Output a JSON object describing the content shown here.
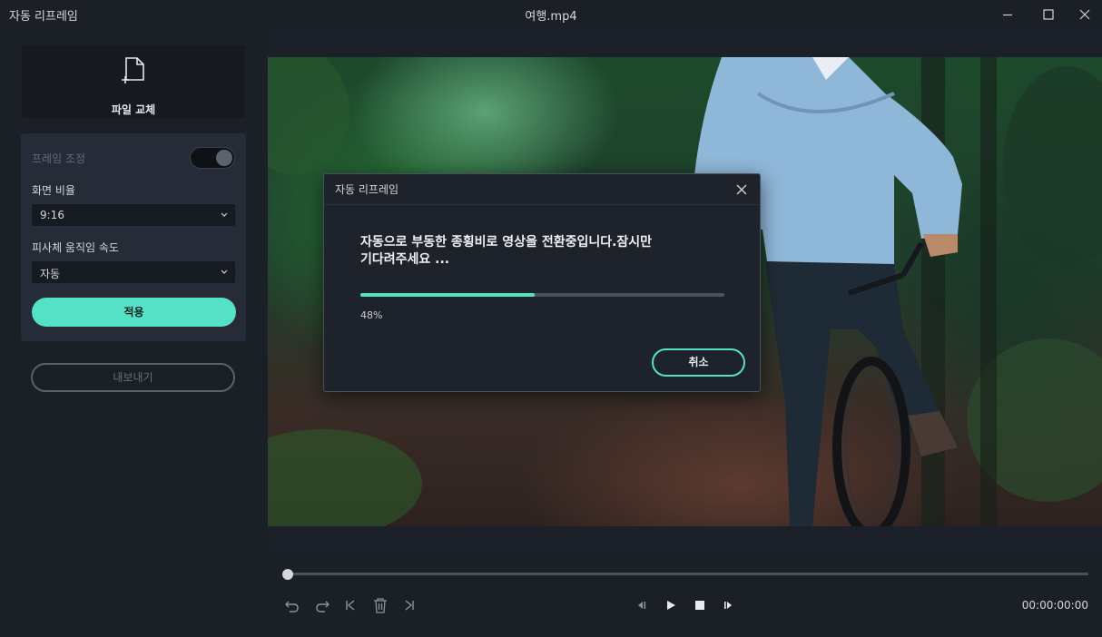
{
  "window": {
    "app_title": "자동 리프레임",
    "file_title": "여행.mp4",
    "controls": [
      "minimize-icon",
      "maximize-icon",
      "close-icon"
    ]
  },
  "left_panel": {
    "replace_file_label": "파일 교체",
    "replace_file_icon": "file-plus-icon",
    "frame_adjust_label": "프레임 조정",
    "frame_adjust_toggle_on": true,
    "aspect_ratio_label": "화면 비율",
    "aspect_ratio_value": "9:16",
    "motion_speed_label": "피사체 움직임 속도",
    "motion_speed_value": "자동",
    "apply_label": "적용",
    "export_label": "내보내기"
  },
  "dialog": {
    "title": "자동 리프레임",
    "message": "자동으로 부동한 종횡비로 영상을 전환중입니다.잠시만\n기다려주세요 ...",
    "progress": 48,
    "progress_text": "48%",
    "cancel_label": "취소"
  },
  "playback": {
    "timecode": "00:00:00:00",
    "seek_position": 0
  },
  "colors": {
    "accent": "#54e1c5",
    "background": "#1b1f26",
    "card": "#252c38"
  }
}
